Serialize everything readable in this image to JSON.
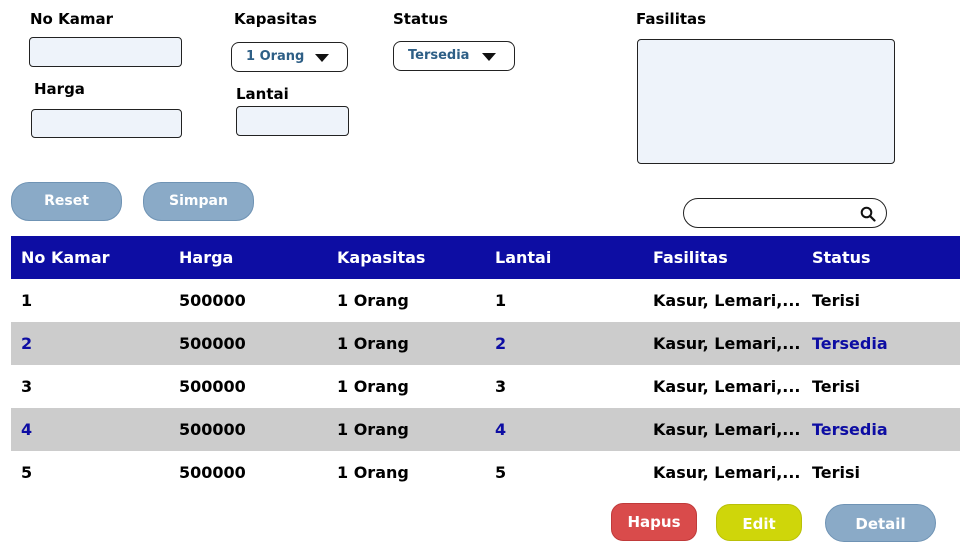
{
  "form": {
    "no_kamar_label": "No Kamar",
    "harga_label": "Harga",
    "kapasitas_label": "Kapasitas",
    "kapasitas_value": "1 Orang",
    "lantai_label": "Lantai",
    "status_label": "Status",
    "status_value": "Tersedia",
    "fasilitas_label": "Fasilitas",
    "reset_label": "Reset",
    "simpan_label": "Simpan"
  },
  "table": {
    "headers": [
      "No Kamar",
      "Harga",
      "Kapasitas",
      "Lantai",
      "Fasilitas",
      "Status"
    ],
    "rows": [
      [
        "1",
        "500000",
        "1 Orang",
        "1",
        "Kasur, Lemari,....",
        "Terisi"
      ],
      [
        "2",
        "500000",
        "1 Orang",
        "2",
        "Kasur, Lemari,....",
        "Tersedia"
      ],
      [
        "3",
        "500000",
        "1 Orang",
        "3",
        "Kasur, Lemari,....",
        "Terisi"
      ],
      [
        "4",
        "500000",
        "1 Orang",
        "4",
        "Kasur, Lemari,....",
        "Tersedia"
      ],
      [
        "5",
        "500000",
        "1 Orang",
        "5",
        "Kasur, Lemari,....",
        "Terisi"
      ]
    ]
  },
  "actions": {
    "hapus_label": "Hapus",
    "edit_label": "Edit",
    "detail_label": "Detail"
  },
  "colors": {
    "header_bg": "#0d0da3",
    "alt_row_bg": "#cccccc",
    "hapus": "#d94b4b",
    "edit": "#cfd60a",
    "detail": "#8aaac7"
  },
  "icons": {
    "search": "search-icon",
    "dropdown": "chevron-down-icon"
  }
}
